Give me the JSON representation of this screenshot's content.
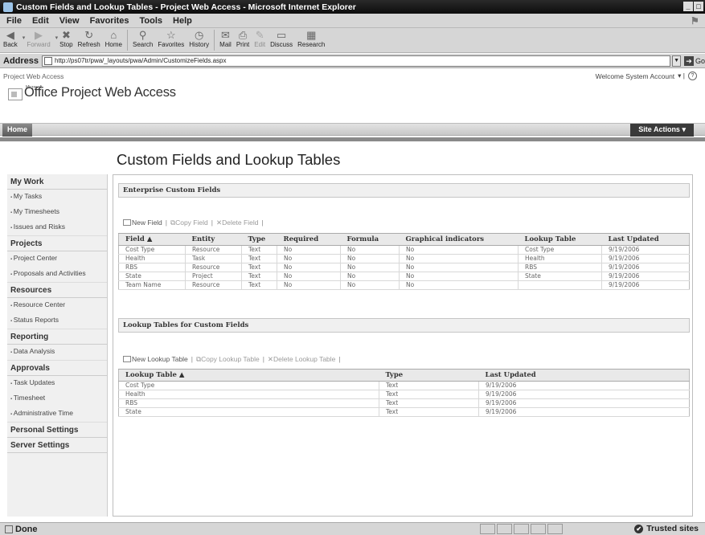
{
  "window": {
    "title": "Custom Fields and Lookup Tables - Project Web Access - Microsoft Internet Explorer"
  },
  "menu": [
    "File",
    "Edit",
    "View",
    "Favorites",
    "Tools",
    "Help"
  ],
  "toolbar": {
    "back": "Back",
    "forward": "Forward",
    "stop": "Stop",
    "refresh": "Refresh",
    "home": "Home",
    "search": "Search",
    "favorites": "Favorites",
    "history": "History",
    "mail": "Mail",
    "print": "Print",
    "edit": "Edit",
    "discuss": "Discuss",
    "research": "Research"
  },
  "address": {
    "label": "Address",
    "url": "http://ps07tr/pwa/_layouts/pwa/Admin/CustomizeFields.aspx",
    "go": "Go"
  },
  "pwa": {
    "breadcrumb": "Project Web Access",
    "welcome": "Welcome System Account",
    "logo_small": "Microsoft",
    "logo": "Office Project Web Access",
    "home_tab": "Home",
    "site_actions": "Site Actions"
  },
  "page_title": "Custom Fields and Lookup Tables",
  "leftnav": {
    "my_work": {
      "header": "My Work",
      "items": [
        "My Tasks",
        "My Timesheets",
        "Issues and Risks"
      ]
    },
    "projects": {
      "header": "Projects",
      "items": [
        "Project Center",
        "Proposals and Activities"
      ]
    },
    "resources": {
      "header": "Resources",
      "items": [
        "Resource Center",
        "Status Reports"
      ]
    },
    "reporting": {
      "header": "Reporting",
      "items": [
        "Data Analysis"
      ]
    },
    "approvals": {
      "header": "Approvals",
      "items": [
        "Task Updates",
        "Timesheet",
        "Administrative Time"
      ]
    },
    "personal_settings": "Personal Settings",
    "server_settings": "Server Settings"
  },
  "enterprise": {
    "header": "Enterprise Custom Fields",
    "actions": {
      "new": "New Field",
      "copy": "Copy Field",
      "delete": "Delete Field"
    },
    "columns": [
      "Field",
      "Entity",
      "Type",
      "Required",
      "Formula",
      "Graphical indicators",
      "Lookup Table",
      "Last Updated"
    ],
    "rows": [
      [
        "Cost Type",
        "Resource",
        "Text",
        "No",
        "No",
        "No",
        "Cost Type",
        "9/19/2006"
      ],
      [
        "Health",
        "Task",
        "Text",
        "No",
        "No",
        "No",
        "Health",
        "9/19/2006"
      ],
      [
        "RBS",
        "Resource",
        "Text",
        "No",
        "No",
        "No",
        "RBS",
        "9/19/2006"
      ],
      [
        "State",
        "Project",
        "Text",
        "No",
        "No",
        "No",
        "State",
        "9/19/2006"
      ],
      [
        "Team Name",
        "Resource",
        "Text",
        "No",
        "No",
        "No",
        "",
        "9/19/2006"
      ]
    ]
  },
  "lookup": {
    "header": "Lookup Tables for Custom Fields",
    "actions": {
      "new": "New Lookup Table",
      "copy": "Copy Lookup Table",
      "delete": "Delete Lookup Table"
    },
    "columns": [
      "Lookup Table",
      "Type",
      "Last Updated"
    ],
    "rows": [
      [
        "Cost Type",
        "Text",
        "9/19/2006"
      ],
      [
        "Health",
        "Text",
        "9/19/2006"
      ],
      [
        "RBS",
        "Text",
        "9/19/2006"
      ],
      [
        "State",
        "Text",
        "9/19/2006"
      ]
    ]
  },
  "status": {
    "text": "Done",
    "zone": "Trusted sites"
  }
}
